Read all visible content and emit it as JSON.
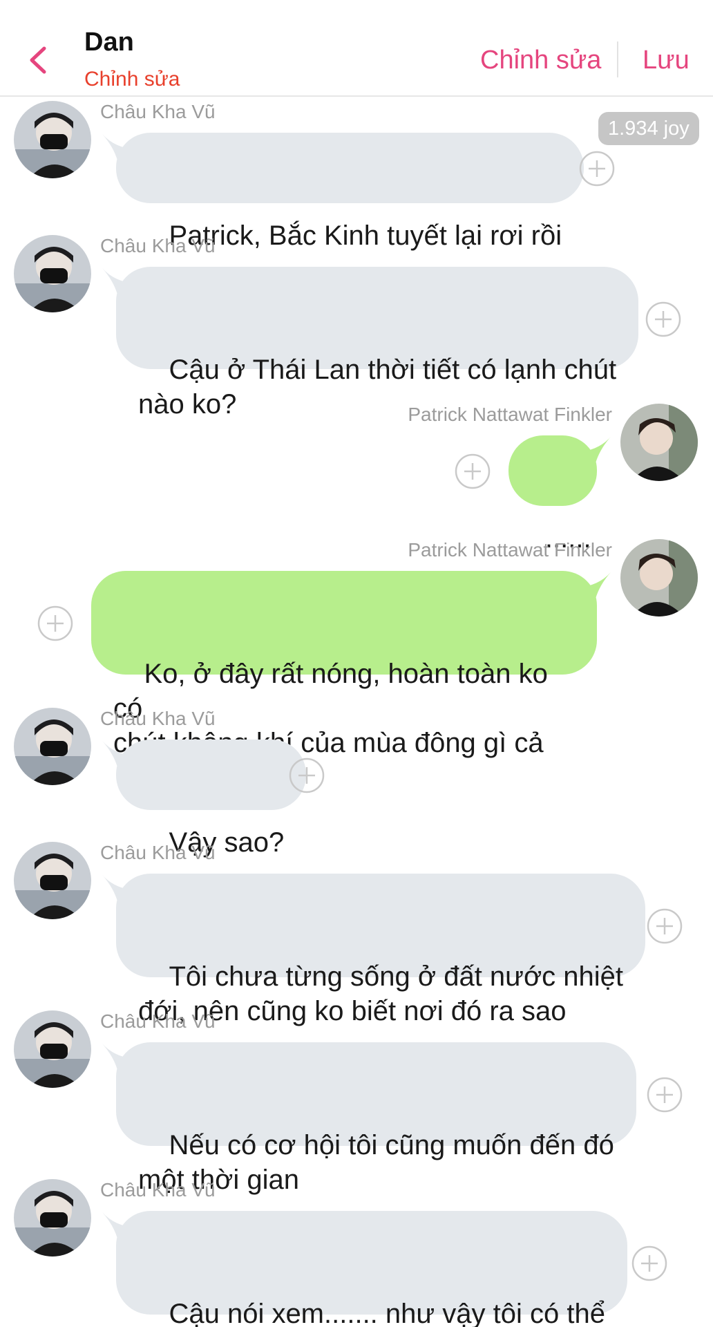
{
  "header": {
    "title": "Dan",
    "subtitle": "Chỉnh sửa",
    "edit_label": "Chỉnh sửa",
    "save_label": "Lưu"
  },
  "badge": {
    "joy": "1.934 joy"
  },
  "messages": [
    {
      "side": "left",
      "sender": "Châu Kha Vũ",
      "text": "Patrick, Bắc Kinh tuyết lại rơi rồi"
    },
    {
      "side": "left",
      "sender": "Châu Kha Vũ",
      "text": "Cậu ở Thái Lan thời tiết có lạnh chút\nnào ko?"
    },
    {
      "side": "right",
      "sender": "Patrick Nattawat Finkler",
      "text": "......"
    },
    {
      "side": "right",
      "sender": "Patrick Nattawat Finkler",
      "text": "Ko, ở đây rất nóng, hoàn toàn ko có\nchút không khí của mùa đông gì cả"
    },
    {
      "side": "left",
      "sender": "Châu Kha Vũ",
      "text": "Vậy sao?"
    },
    {
      "side": "left",
      "sender": "Châu Kha Vũ",
      "text": "Tôi chưa từng sống ở đất nước nhiệt\nđới, nên cũng ko biết nơi đó ra sao"
    },
    {
      "side": "left",
      "sender": "Châu Kha Vũ",
      "text": "Nếu có cơ hội tôi cũng muốn đến đó\nmột thời gian"
    },
    {
      "side": "left",
      "sender": "Châu Kha Vũ",
      "text": "Cậu nói xem....... như vậy tôi có thể\nhiểu cậu thêm hay ko"
    }
  ],
  "colors": {
    "accent": "#e5457e",
    "subtitle": "#e8402c",
    "bubble_gray": "#e4e8ec",
    "bubble_green": "#b7ee8c"
  },
  "icons": {
    "back": "chevron-left-icon",
    "add": "plus-circle-icon"
  }
}
